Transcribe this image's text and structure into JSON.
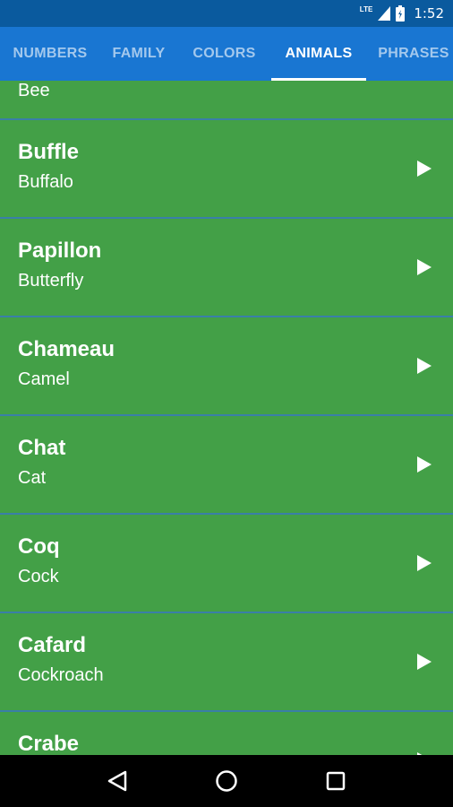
{
  "status_bar": {
    "network": "LTE",
    "time": "1:52",
    "icons": [
      "lte-icon",
      "signal-icon",
      "battery-icon"
    ]
  },
  "tabs": [
    {
      "label": "NUMBERS",
      "active": false
    },
    {
      "label": "FAMILY",
      "active": false
    },
    {
      "label": "COLORS",
      "active": false
    },
    {
      "label": "ANIMALS",
      "active": true
    },
    {
      "label": "PHRASES",
      "active": false
    }
  ],
  "list": {
    "partial_top": {
      "english": "Bee"
    },
    "items": [
      {
        "french": "Buffle",
        "english": "Buffalo"
      },
      {
        "french": "Papillon",
        "english": "Butterfly"
      },
      {
        "french": "Chameau",
        "english": "Camel"
      },
      {
        "french": "Chat",
        "english": "Cat"
      },
      {
        "french": "Coq",
        "english": "Cock"
      },
      {
        "french": "Cafard",
        "english": "Cockroach"
      },
      {
        "french": "Crabe",
        "english": ""
      }
    ],
    "item_icon": "play-icon"
  },
  "nav_bar": {
    "icons": [
      "back-icon",
      "home-icon",
      "recents-icon"
    ]
  },
  "colors": {
    "status_bar": "#0a5a9e",
    "tab_bar": "#1976d2",
    "list_background": "#43a047",
    "divider": "#3a7fa8"
  }
}
